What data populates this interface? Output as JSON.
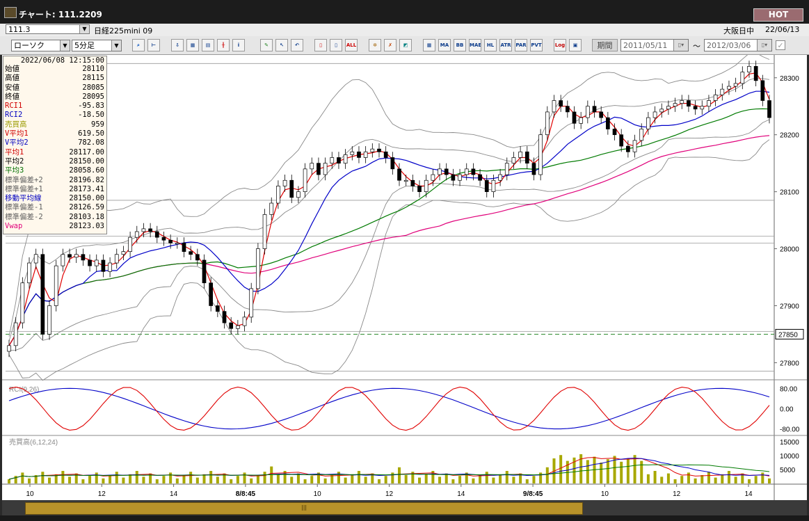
{
  "window": {
    "title": "チャート: 111.2209",
    "hot_label": "HOT"
  },
  "toolbar1": {
    "symbol_code": "111.3",
    "symbol_name": "日経225mini 09",
    "market": "大阪日中",
    "date": "22/06/13"
  },
  "toolbar2": {
    "chart_type": "ローソク",
    "interval": "5分足",
    "period_label": "期間",
    "date_from": "2011/05/11",
    "date_sep": "〜",
    "date_to": "2012/03/06",
    "buttons": [
      "MA",
      "BB",
      "MAE",
      "HL",
      "ATR",
      "PAR",
      "PVT",
      "Log",
      "ALL"
    ]
  },
  "info": {
    "datetime": "2022/06/08  12:15:00",
    "rows": [
      {
        "label": "始値",
        "value": "28110",
        "color": "#000000"
      },
      {
        "label": "高値",
        "value": "28115",
        "color": "#000000"
      },
      {
        "label": "安値",
        "value": "28085",
        "color": "#000000"
      },
      {
        "label": "終値",
        "value": "28095",
        "color": "#000000"
      },
      {
        "label": "RCI1",
        "value": "-95.83",
        "color": "#d00000"
      },
      {
        "label": "RCI2",
        "value": "-18.50",
        "color": "#0000c0"
      },
      {
        "label": "売買高",
        "value": "959",
        "color": "#9a9a00"
      },
      {
        "label": "V平均1",
        "value": "619.50",
        "color": "#d00000"
      },
      {
        "label": "V平均2",
        "value": "782.08",
        "color": "#0000c0"
      },
      {
        "label": "平均1",
        "value": "28117.00",
        "color": "#d00000"
      },
      {
        "label": "平均2",
        "value": "28150.00",
        "color": "#000000"
      },
      {
        "label": "平均3",
        "value": "28058.60",
        "color": "#007000"
      },
      {
        "label": "標準偏差+2",
        "value": "28196.82",
        "color": "#606060"
      },
      {
        "label": "標準偏差+1",
        "value": "28173.41",
        "color": "#606060"
      },
      {
        "label": "移動平均線",
        "value": "28150.00",
        "color": "#0000c0"
      },
      {
        "label": "標準偏差-1",
        "value": "28126.59",
        "color": "#606060"
      },
      {
        "label": "標準偏差-2",
        "value": "28103.18",
        "color": "#606060"
      },
      {
        "label": "Vwap",
        "value": "28123.03",
        "color": "#e0007a"
      }
    ]
  },
  "price_axis": {
    "ticks": [
      "28300",
      "28200",
      "28100",
      "28000",
      "27900",
      "27800"
    ],
    "current_marker": "27850"
  },
  "rci_panel": {
    "label": "RCI(9,26)",
    "ticks": [
      "80.00",
      "0.00",
      "-80.00"
    ]
  },
  "volume_panel": {
    "label": "売買高(6,12,24)",
    "ticks": [
      "15000",
      "10000",
      "5000"
    ]
  },
  "time_axis": {
    "labels": [
      "10",
      "12",
      "14",
      "8/8:45",
      "10",
      "12",
      "14",
      "9/8:45",
      "10",
      "12",
      "14"
    ]
  },
  "colors": {
    "ma_red": "#e00000",
    "ma_blue": "#0000c8",
    "ma_green": "#007a00",
    "vwap": "#e0007a",
    "band": "#888888",
    "volume_bar": "#a8a800",
    "dashed": "#2e8b2e"
  },
  "chart_data": {
    "type": "candlestick",
    "interval": "5分足",
    "ylim": [
      27770,
      28340
    ],
    "close_series": [
      27830,
      27870,
      27940,
      27975,
      27990,
      27850,
      27900,
      27970,
      27990,
      27985,
      27990,
      27980,
      27970,
      27980,
      27960,
      27975,
      27990,
      27995,
      28020,
      28030,
      28035,
      28030,
      28020,
      28015,
      28010,
      28010,
      27995,
      27990,
      27980,
      27940,
      27900,
      27890,
      27870,
      27860,
      27865,
      27880,
      27930,
      28000,
      28060,
      28080,
      28110,
      28120,
      28090,
      28100,
      28140,
      28150,
      28130,
      28150,
      28160,
      28150,
      28165,
      28170,
      28160,
      28170,
      28175,
      28170,
      28160,
      28140,
      28120,
      28120,
      28110,
      28100,
      28120,
      28130,
      28140,
      28130,
      28120,
      28130,
      28140,
      28130,
      28120,
      28100,
      28120,
      28130,
      28150,
      28160,
      28170,
      28150,
      28130,
      28200,
      28240,
      28260,
      28250,
      28240,
      28220,
      28230,
      28250,
      28240,
      28230,
      28210,
      28200,
      28180,
      28170,
      28190,
      28210,
      28230,
      28240,
      28245,
      28250,
      28255,
      28260,
      28250,
      28245,
      28250,
      28260,
      28270,
      28280,
      28285,
      28290,
      28310,
      28320,
      28295,
      28260,
      28230
    ]
  }
}
